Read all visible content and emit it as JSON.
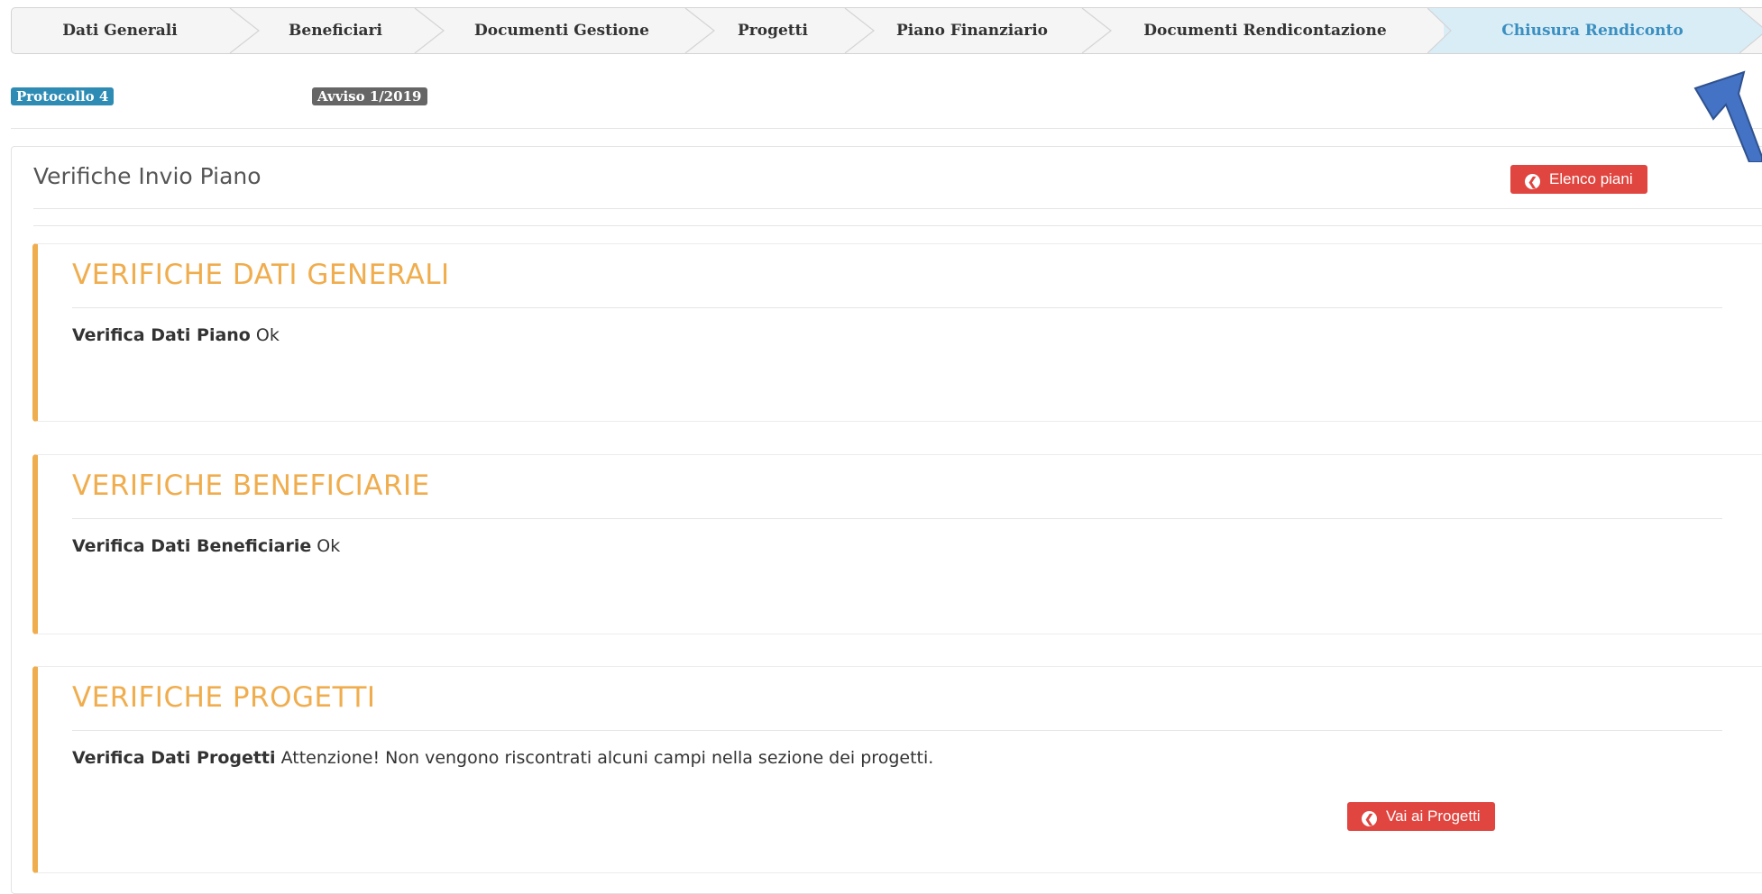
{
  "wizard": {
    "steps": [
      {
        "label": "Dati Generali"
      },
      {
        "label": "Beneficiari"
      },
      {
        "label": "Documenti Gestione"
      },
      {
        "label": "Progetti"
      },
      {
        "label": "Piano Finanziario"
      },
      {
        "label": "Documenti Rendicontazione"
      },
      {
        "label": "Chiusura Rendiconto",
        "active": true
      }
    ]
  },
  "badges": {
    "protocollo": "Protocollo 4",
    "avviso": "Avviso 1/2019"
  },
  "panel": {
    "title": "Verifiche Invio Piano",
    "back_button_label": "Elenco piani"
  },
  "checks": [
    {
      "heading": "VERIFICHE DATI GENERALI",
      "label": "Verifica Dati Piano",
      "result": "Ok"
    },
    {
      "heading": "VERIFICHE BENEFICIARIE",
      "label": "Verifica Dati Beneficiarie",
      "result": "Ok"
    },
    {
      "heading": "VERIFICHE PROGETTI",
      "label": "Verifica Dati Progetti",
      "result": "Attenzione! Non vengono riscontrati alcuni campi nella sezione dei progetti.",
      "action_label": "Vai ai Progetti"
    }
  ],
  "colors": {
    "accent_warning": "#f0ad4e",
    "danger_button": "#e0453f",
    "active_step_text": "#3a8fc0",
    "active_step_bg": "#d9edf7",
    "annotation_arrow": "#4472c4"
  },
  "icons": {
    "back_button_icon": "circle-arrow-left-icon",
    "annotation": "pointer-arrow-icon"
  }
}
